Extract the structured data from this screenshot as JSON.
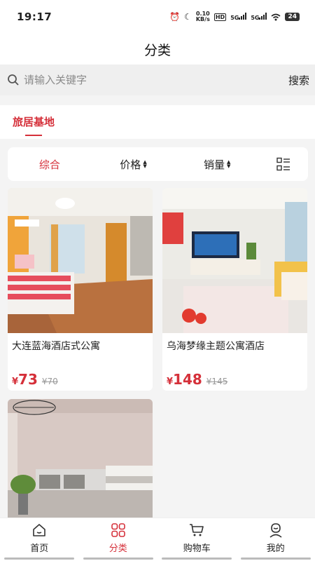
{
  "status_bar": {
    "time": "19:17",
    "net_speed_top": "0.10",
    "net_speed_unit": "KB/s",
    "hd": "HD",
    "sim1": "5G",
    "sim2": "5G",
    "battery": "24"
  },
  "header": {
    "title": "分类"
  },
  "search": {
    "placeholder": "请输入关键字",
    "value": "",
    "button_label": "搜索"
  },
  "tabs": [
    {
      "label": "旅居基地",
      "active": true
    }
  ],
  "filters": {
    "items": [
      {
        "label": "综合",
        "active": true
      },
      {
        "label": "价格"
      },
      {
        "label": "销量"
      }
    ],
    "layout_icon": "list-grid-icon"
  },
  "products": [
    {
      "name": "大连蓝海酒店式公寓",
      "currency": "¥",
      "price": "73",
      "original_price": "¥70"
    },
    {
      "name": "乌海梦缘主题公寓酒店",
      "currency": "¥",
      "price": "148",
      "original_price": "¥145"
    },
    {
      "name": "",
      "currency": "",
      "price": "",
      "original_price": ""
    }
  ],
  "bottom_nav": [
    {
      "label": "首页",
      "icon": "home-icon"
    },
    {
      "label": "分类",
      "icon": "category-grid-icon",
      "active": true
    },
    {
      "label": "购物车",
      "icon": "cart-icon"
    },
    {
      "label": "我的",
      "icon": "profile-icon"
    }
  ],
  "colors": {
    "accent": "#d5303a"
  }
}
